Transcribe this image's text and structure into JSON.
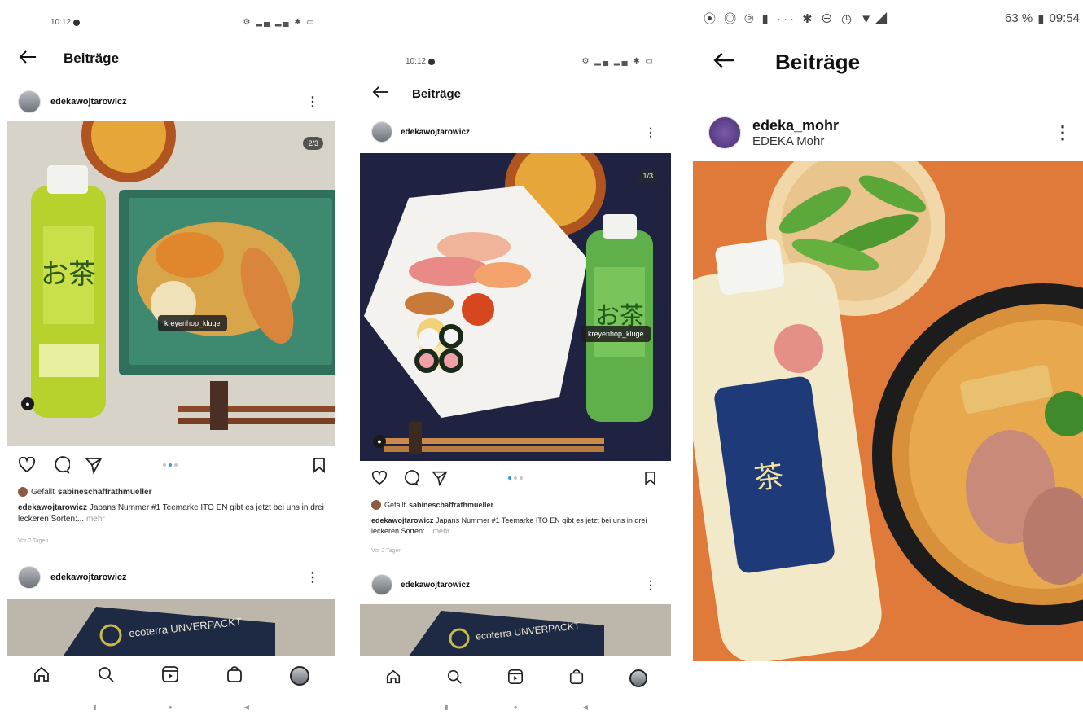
{
  "screens": [
    {
      "time": "10:12",
      "title": "Beiträge",
      "post1_user": "edekawojtarowicz",
      "counter": "2/3",
      "product_tag": "kreyenhop_kluge",
      "liked_by_prefix": "Gefällt",
      "liked_by_user": "sabineschaffrathmueller",
      "caption_user": "edekawojtarowicz",
      "caption_text": "Japans Nummer #1 Teemarke ITO EN gibt es jetzt bei uns in drei leckeren Sorten:...",
      "caption_more": "mehr",
      "ago": "Vor 2 Tagen",
      "post2_user": "edekawojtarowicz",
      "banner_text": "ecoterra UNVERPACKT"
    },
    {
      "time": "10:12",
      "title": "Beiträge",
      "post1_user": "edekawojtarowicz",
      "counter": "1/3",
      "product_tag": "kreyenhop_kluge",
      "liked_by_prefix": "Gefällt",
      "liked_by_user": "sabineschaffrathmueller",
      "caption_user": "edekawojtarowicz",
      "caption_text": "Japans Nummer #1 Teemarke ITO EN gibt es jetzt bei uns in drei leckeren Sorten:...",
      "caption_more": "mehr",
      "ago": "Vor 2 Tagen",
      "post2_user": "edekawojtarowicz",
      "banner_text": "ecoterra UNVERPACKT"
    },
    {
      "status_icons": "⦿ ◎ ℗ ▮ ··· ✱ ⊖ ◷ ▼◢",
      "battery": "63 %",
      "time": "09:54",
      "title": "Beiträge",
      "post_user": "edeka_mohr",
      "post_fullname": "EDEKA Mohr"
    }
  ],
  "colors": {
    "like_dot_active": "#3897f0",
    "orange_bg": "#e07a3a",
    "navy_bg": "#1f2240",
    "stone_bg": "#d8d3c8"
  },
  "icons": [
    "back-arrow-icon",
    "more-vertical-icon",
    "heart-icon",
    "comment-icon",
    "share-icon",
    "bookmark-icon",
    "home-icon",
    "search-icon",
    "reels-icon",
    "shop-icon",
    "profile-avatar"
  ]
}
